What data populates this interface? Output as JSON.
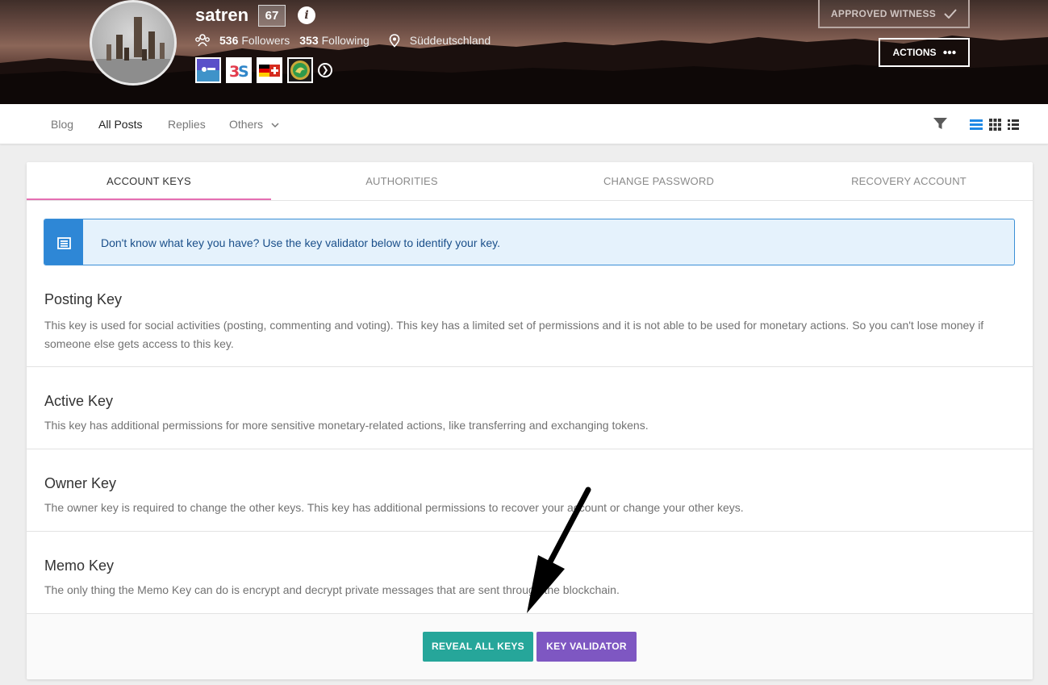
{
  "profile": {
    "username": "satren",
    "reputation": "67",
    "followers_count": "536",
    "followers_label": "Followers",
    "following_count": "353",
    "following_label": "Following",
    "location": "Süddeutschland",
    "witness_label": "APPROVED WITNESS",
    "actions_label": "ACTIONS",
    "badge_icons": [
      "top-badge-icon",
      "3s-badge-icon",
      "flag-badge-icon",
      "dragon-badge-icon"
    ]
  },
  "nav": {
    "items": [
      "Blog",
      "All Posts",
      "Replies",
      "Others"
    ],
    "active": "All Posts"
  },
  "tabs": {
    "items": [
      "ACCOUNT KEYS",
      "AUTHORITIES",
      "CHANGE PASSWORD",
      "RECOVERY ACCOUNT"
    ],
    "active": "ACCOUNT KEYS"
  },
  "notice": {
    "text": "Don't know what key you have? Use the key validator below to identify your key."
  },
  "keys": [
    {
      "title": "Posting Key",
      "description": "This key is used for social activities (posting, commenting and voting). This key has a limited set of permissions and it is not able to be used for monetary actions. So you can't lose money if someone else gets access to this key."
    },
    {
      "title": "Active Key",
      "description": "This key has additional permissions for more sensitive monetary-related actions, like transferring and exchanging tokens."
    },
    {
      "title": "Owner Key",
      "description": "The owner key is required to change the other keys. This key has additional permissions to recover your account or change your other keys."
    },
    {
      "title": "Memo Key",
      "description": "The only thing the Memo Key can do is encrypt and decrypt private messages that are sent through the blockchain."
    }
  ],
  "buttons": {
    "reveal": "REVEAL ALL KEYS",
    "validator": "KEY VALIDATOR"
  },
  "colors": {
    "accent_tab": "#e56fb2",
    "notice_blue": "#2e87d6",
    "reveal_green": "#26a69a",
    "validator_purple": "#7e57c2",
    "view_active": "#1e88e5"
  }
}
